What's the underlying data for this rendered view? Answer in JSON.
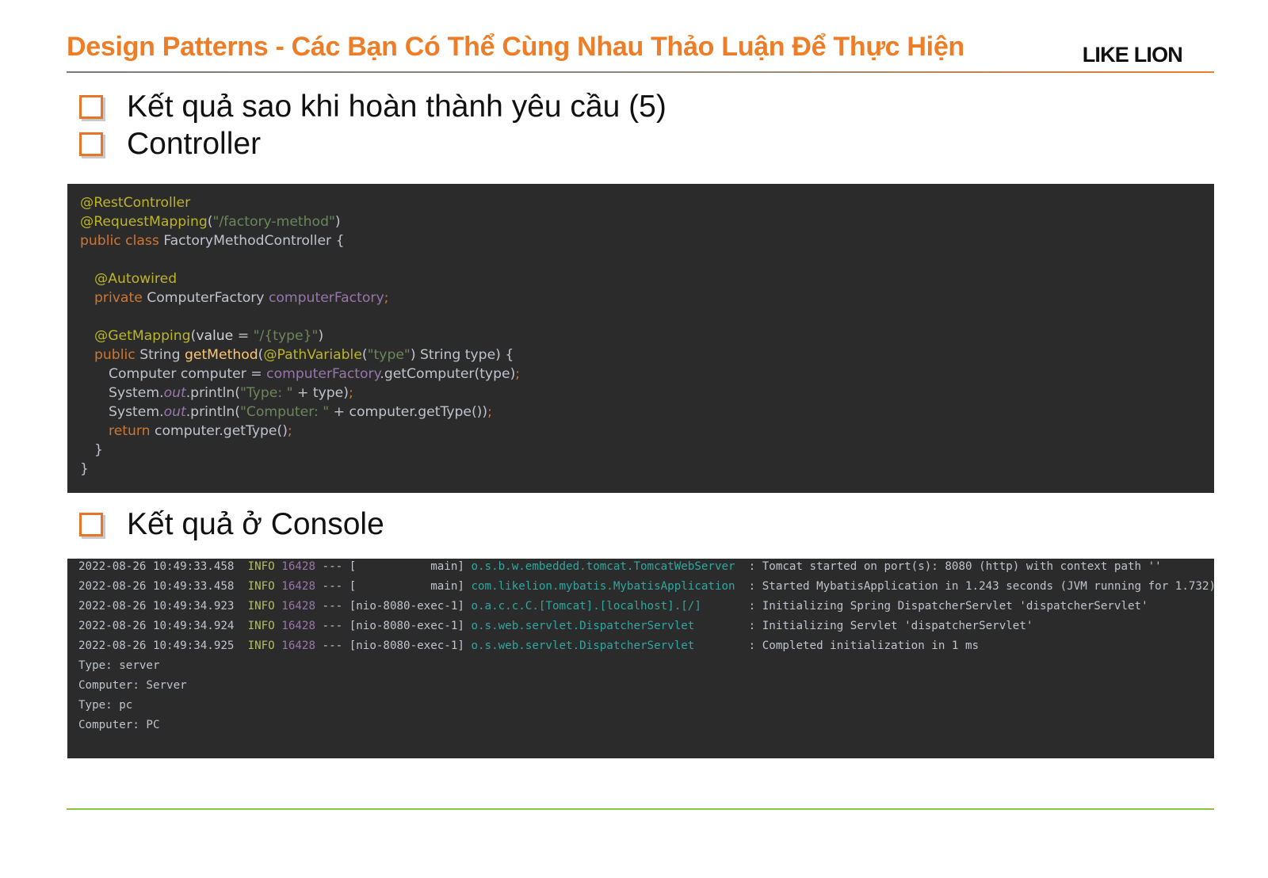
{
  "header": {
    "title": "Design Patterns - Các Bạn Có Thể Cùng Nhau Thảo Luận Để Thực Hiện",
    "logo": "LIKE LION"
  },
  "bullets": [
    "Kết quả sao khi hoàn thành yêu cầu (5)",
    "Controller",
    "Kết quả ở Console"
  ],
  "code": {
    "l1": "@RestController",
    "l2_ann": "@RequestMapping",
    "l2_open": "(",
    "l2_str": "\"/factory-method\"",
    "l2_close": ")",
    "l3_kw": "public class ",
    "l3_rest": "FactoryMethodController {",
    "l5": "@Autowired",
    "l6_kw": "private ",
    "l6_type": "ComputerFactory ",
    "l6_field": "computerFactory",
    "l6_end": ";",
    "l8_ann": "@GetMapping",
    "l8_open": "(",
    "l8_attr": "value",
    "l8_eq": " = ",
    "l8_str": "\"/{type}\"",
    "l8_close": ")",
    "l9_kw": "public ",
    "l9_type": "String ",
    "l9_fn": "getMethod",
    "l9_open": "(",
    "l9_ann": "@PathVariable",
    "l9_p1": "(",
    "l9_str": "\"type\"",
    "l9_rest": ") String type) {",
    "l10_a": "Computer computer = ",
    "l10_field": "computerFactory",
    "l10_b": ".getComputer(type)",
    "l10_end": ";",
    "l11_a": "System.",
    "l11_out": "out",
    "l11_b": ".println(",
    "l11_str": "\"Type: \"",
    "l11_c": " + type)",
    "l11_end": ";",
    "l12_a": "System.",
    "l12_out": "out",
    "l12_b": ".println(",
    "l12_str": "\"Computer: \"",
    "l12_c": " + computer.getType())",
    "l12_end": ";",
    "l13_kw": "return ",
    "l13_rest": "computer.getType()",
    "l13_end": ";",
    "l14": "}",
    "l15": "}"
  },
  "console": {
    "logs": [
      {
        "ts": "2022-08-26 10:49:33.458",
        "level": "INFO",
        "pid": "16428",
        "thread": " --- [           main] ",
        "logger": "o.s.b.w.embedded.tomcat.TomcatWebServer ",
        "msg": " : Tomcat started on port(s): 8080 (http) with context path ''"
      },
      {
        "ts": "2022-08-26 10:49:33.458",
        "level": "INFO",
        "pid": "16428",
        "thread": " --- [           main] ",
        "logger": "com.likelion.mybatis.MybatisApplication ",
        "msg": " : Started MybatisApplication in 1.243 seconds (JVM running for 1.732)"
      },
      {
        "ts": "2022-08-26 10:49:34.923",
        "level": "INFO",
        "pid": "16428",
        "thread": " --- [nio-8080-exec-1] ",
        "logger": "o.a.c.c.C.[Tomcat].[localhost].[/]      ",
        "msg": " : Initializing Spring DispatcherServlet 'dispatcherServlet'"
      },
      {
        "ts": "2022-08-26 10:49:34.924",
        "level": "INFO",
        "pid": "16428",
        "thread": " --- [nio-8080-exec-1] ",
        "logger": "o.s.web.servlet.DispatcherServlet       ",
        "msg": " : Initializing Servlet 'dispatcherServlet'"
      },
      {
        "ts": "2022-08-26 10:49:34.925",
        "level": "INFO",
        "pid": "16428",
        "thread": " --- [nio-8080-exec-1] ",
        "logger": "o.s.web.servlet.DispatcherServlet       ",
        "msg": " : Completed initialization in 1 ms"
      }
    ],
    "out1": "Type: server",
    "out2": "Computer: Server",
    "out3": "Type: pc",
    "out4": "Computer: PC"
  },
  "colors": {
    "title": "#ee7d28",
    "code_bg": "#2b2b2b",
    "bottom_rule": "#8bc34a"
  }
}
